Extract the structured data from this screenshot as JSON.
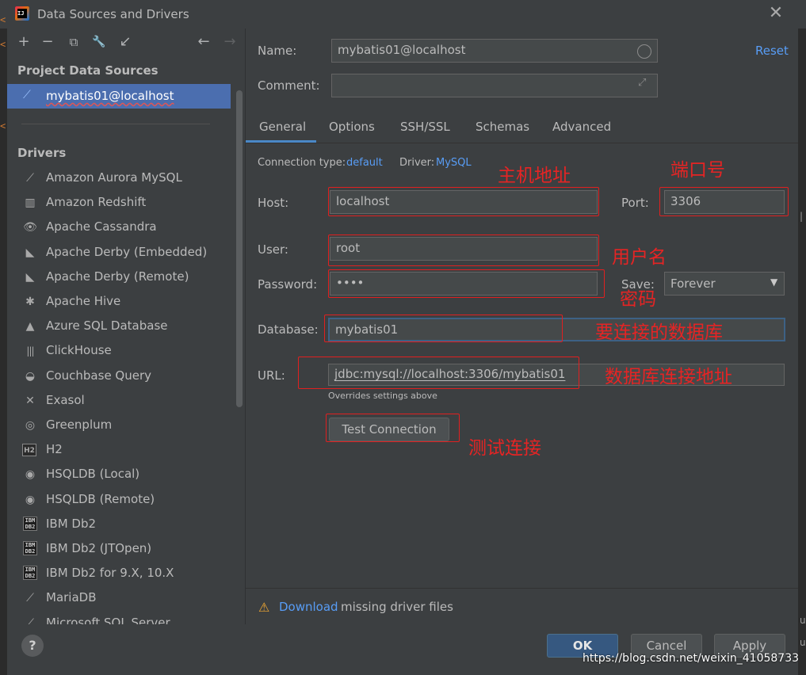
{
  "window": {
    "title": "Data Sources and Drivers",
    "close_glyph": "✕"
  },
  "toolbar": {
    "add": "+",
    "remove": "−",
    "duplicate": "⧉",
    "properties": "🔧",
    "import": "↙",
    "back": "←",
    "forward": "→"
  },
  "left": {
    "project_section": "Project Data Sources",
    "selected_source": "mybatis01@localhost",
    "drivers_section": "Drivers",
    "drivers": [
      {
        "label": "Amazon Aurora MySQL",
        "icon": "dolphin-icon",
        "glyph": "⟋"
      },
      {
        "label": "Amazon Redshift",
        "icon": "redshift-icon",
        "glyph": "▥"
      },
      {
        "label": "Apache Cassandra",
        "icon": "cassandra-icon",
        "glyph": "👁"
      },
      {
        "label": "Apache Derby (Embedded)",
        "icon": "derby-icon",
        "glyph": "◣"
      },
      {
        "label": "Apache Derby (Remote)",
        "icon": "derby-icon",
        "glyph": "◣"
      },
      {
        "label": "Apache Hive",
        "icon": "hive-icon",
        "glyph": "✱"
      },
      {
        "label": "Azure SQL Database",
        "icon": "azure-icon",
        "glyph": "▲"
      },
      {
        "label": "ClickHouse",
        "icon": "clickhouse-icon",
        "glyph": "|||"
      },
      {
        "label": "Couchbase Query",
        "icon": "couchbase-icon",
        "glyph": "◒"
      },
      {
        "label": "Exasol",
        "icon": "exasol-icon",
        "glyph": "✕"
      },
      {
        "label": "Greenplum",
        "icon": "greenplum-icon",
        "glyph": "◎"
      },
      {
        "label": "H2",
        "icon": "h2-icon",
        "glyph": "H2"
      },
      {
        "label": "HSQLDB (Local)",
        "icon": "hsqldb-icon",
        "glyph": "◉"
      },
      {
        "label": "HSQLDB (Remote)",
        "icon": "hsqldb-icon",
        "glyph": "◉"
      },
      {
        "label": "IBM Db2",
        "icon": "ibm-db2-icon",
        "glyph": "IBM DB2"
      },
      {
        "label": "IBM Db2 (JTOpen)",
        "icon": "ibm-db2-icon",
        "glyph": "IBM DB2"
      },
      {
        "label": "IBM Db2 for 9.X, 10.X",
        "icon": "ibm-db2-icon",
        "glyph": "IBM DB2"
      },
      {
        "label": "MariaDB",
        "icon": "mariadb-icon",
        "glyph": "⟋"
      },
      {
        "label": "Microsoft SQL Server",
        "icon": "mssql-icon",
        "glyph": "⟋"
      }
    ],
    "help": "?"
  },
  "form": {
    "name_label": "Name:",
    "name_value": "mybatis01@localhost",
    "reset": "Reset",
    "comment_label": "Comment:",
    "comment_value": "",
    "tabs": [
      "General",
      "Options",
      "SSH/SSL",
      "Schemas",
      "Advanced"
    ],
    "active_tab": "General",
    "connection_type_label": "Connection type:",
    "connection_type_value": "default",
    "driver_label": "Driver:",
    "driver_value": "MySQL",
    "host_label": "Host:",
    "host_value": "localhost",
    "port_label": "Port:",
    "port_value": "3306",
    "user_label": "User:",
    "user_value": "root",
    "password_label": "Password:",
    "password_value": "••••",
    "save_label": "Save:",
    "save_value": "Forever",
    "database_label": "Database:",
    "database_value": "mybatis01",
    "url_label": "URL:",
    "url_value": "jdbc:mysql://localhost:3306/mybatis01",
    "url_hint": "Overrides settings above",
    "test_connection": "Test Connection",
    "warning_link": "Download",
    "warning_text": "missing driver files"
  },
  "buttons": {
    "ok": "OK",
    "cancel": "Cancel",
    "apply": "Apply"
  },
  "annotations": {
    "host": "主机地址",
    "port": "端口号",
    "user": "用户名",
    "password": "密码",
    "database": "要连接的数据库",
    "url": "数据库连接地址",
    "test": "测试连接"
  },
  "watermark": "https://blog.csdn.net/weixin_41058733",
  "colors": {
    "background": "#3c3f41",
    "selection": "#4b6eaf",
    "link": "#589df6",
    "ok_button": "#365880",
    "annotation_red": "#e62424",
    "warning": "#f0a732"
  }
}
